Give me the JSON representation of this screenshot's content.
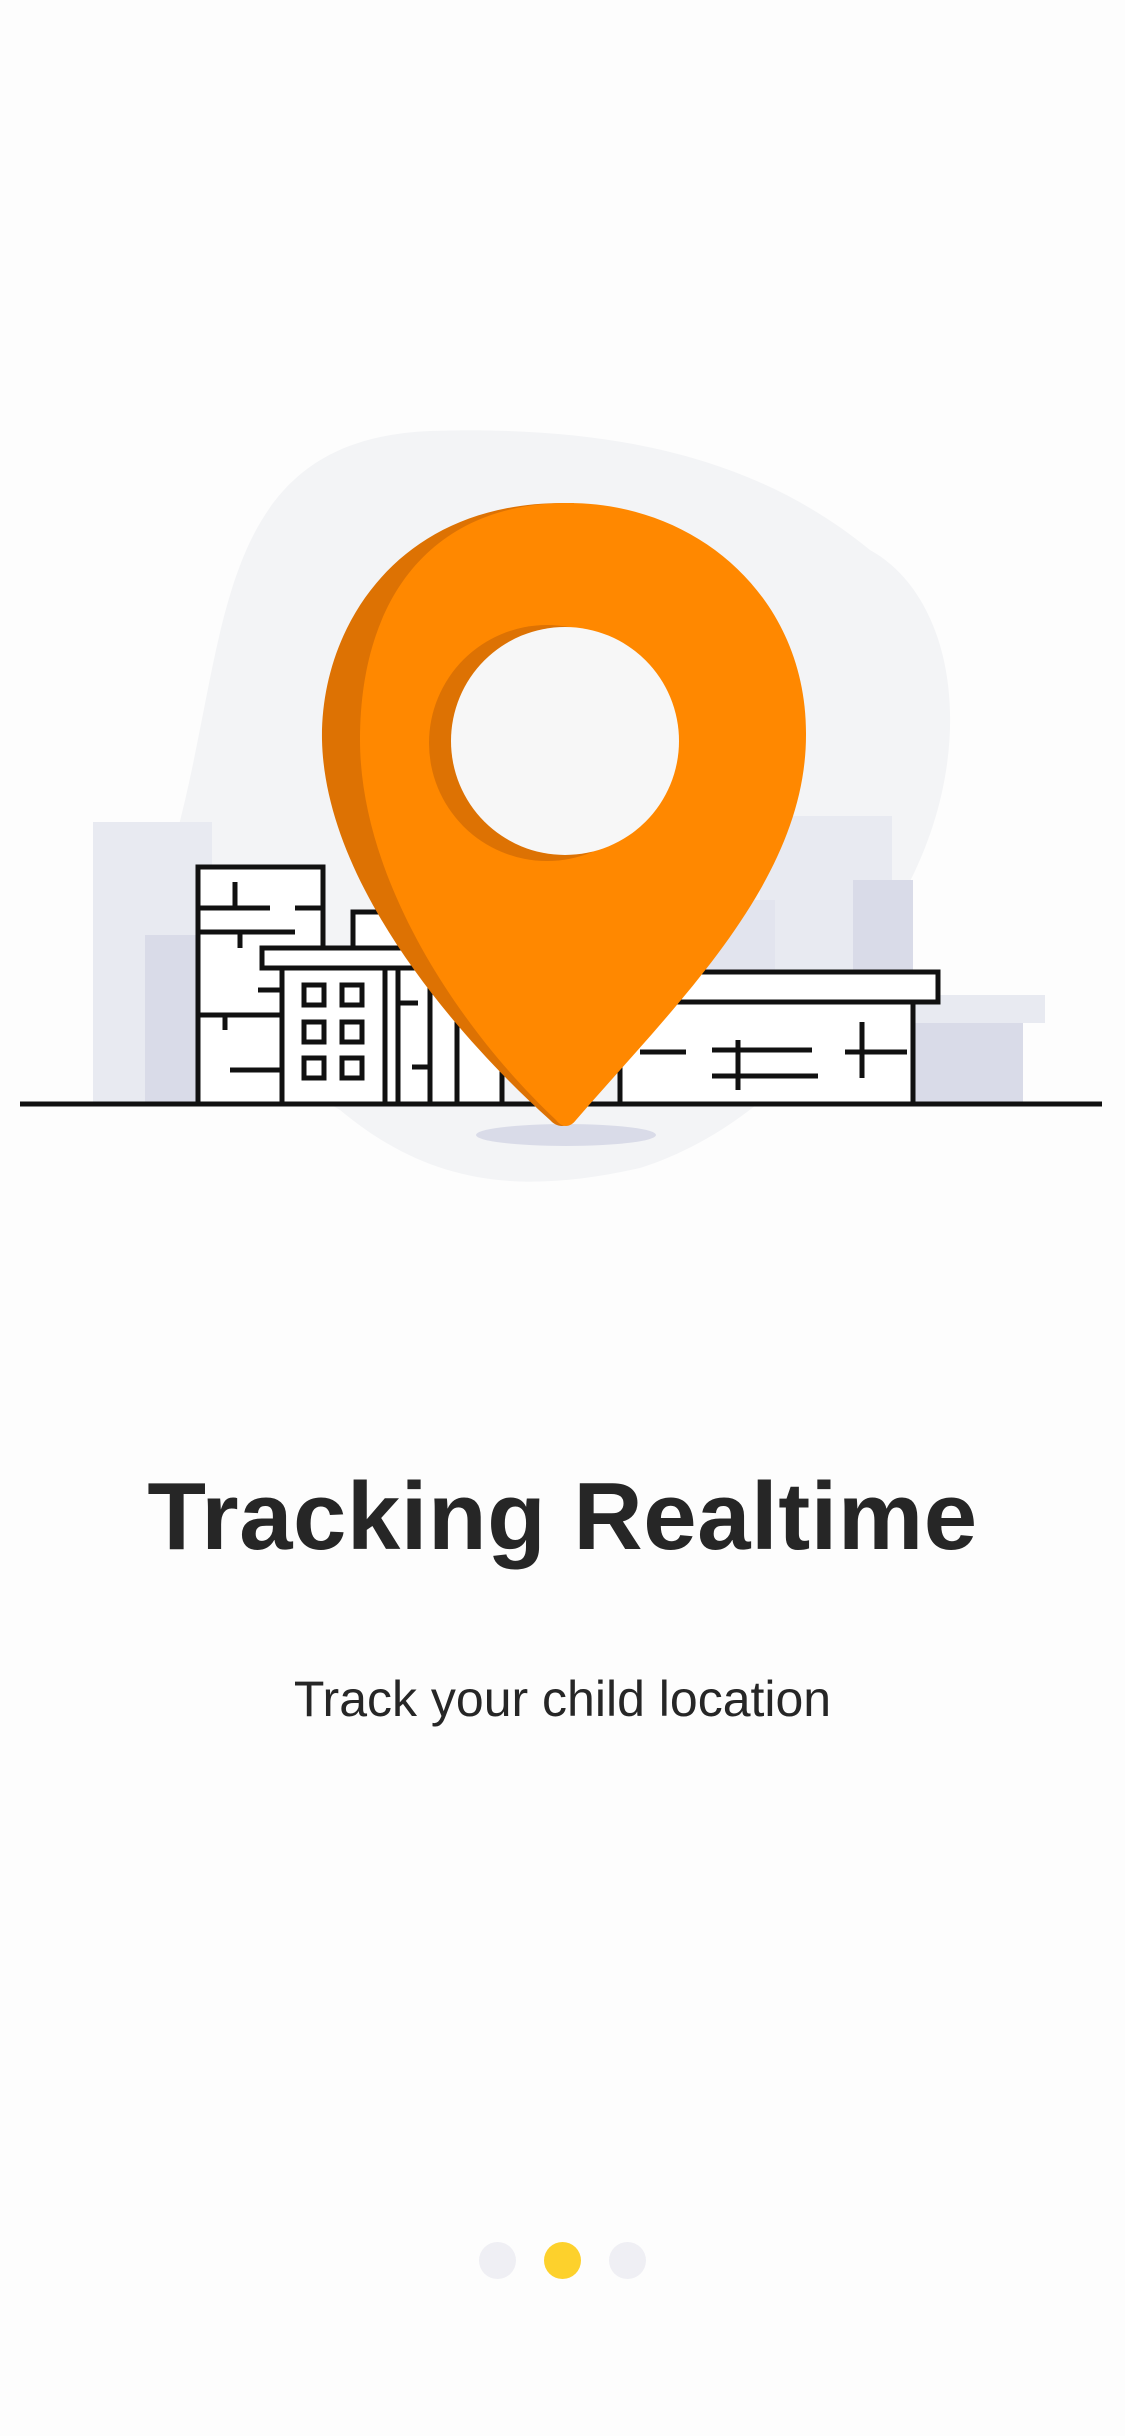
{
  "onboarding": {
    "title": "Tracking Realtime",
    "subtitle": "Track your child location",
    "illustration": {
      "icon": "location-pin-icon",
      "accent_color": "#ff8800",
      "shadow_color": "#dd7203",
      "background_blob_color": "#f3f4f6",
      "building_fill_light": "#e8eaf1",
      "building_fill_dark": "#d9dbe8"
    },
    "pager": {
      "pages": 3,
      "active_index": 1,
      "active_color": "#fdd12c",
      "inactive_color": "#efeff4"
    }
  }
}
